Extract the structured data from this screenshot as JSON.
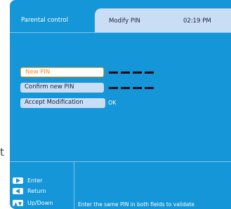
{
  "edge_text": "t",
  "tabs": {
    "active_label": "Parental control",
    "header_title": "Modify PIN",
    "clock": "02:19 PM"
  },
  "form": {
    "new_pin_label": "New PIN",
    "confirm_pin_label": "Confirm new PIN",
    "accept_label": "Accept Modification",
    "accept_status": "OK"
  },
  "footer": {
    "keys": [
      {
        "icon": "right-arrow-icon",
        "label": "Enter"
      },
      {
        "icon": "left-arrow-icon",
        "label": "Return"
      },
      {
        "icon": "up-down-arrow-icon",
        "label": "Up/Down"
      }
    ],
    "hint": "Enter the same PIN in both fields to validate"
  },
  "colors": {
    "screen_bg": "#1596d8",
    "panel": "#c9ddf4",
    "focus_border": "#f5a623",
    "focus_text": "#f58a1f"
  }
}
